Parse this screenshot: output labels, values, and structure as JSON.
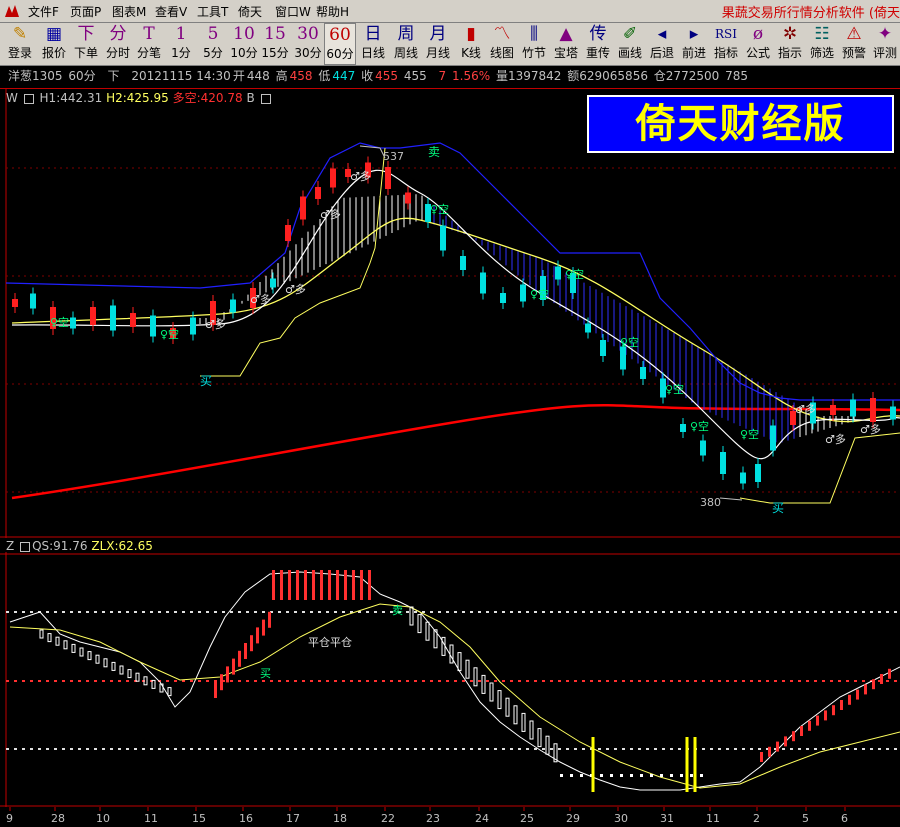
{
  "menubar": {
    "items": [
      "文件F",
      "页面P",
      "图表M",
      "查看V",
      "工具T",
      "倚天",
      "窗口W",
      "帮助H"
    ],
    "right_title": "果蔬交易所行情分析软件 (倚天"
  },
  "toolbar": [
    {
      "icon": "✎",
      "label": "登录",
      "color": "#c08000"
    },
    {
      "icon": "▦",
      "label": "报价",
      "color": "#0000a0"
    },
    {
      "icon": "下",
      "label": "下单",
      "color": "#800080"
    },
    {
      "icon": "分",
      "label": "分时",
      "color": "#800080"
    },
    {
      "icon": "T",
      "label": "分笔",
      "color": "#800080"
    },
    {
      "icon": "1",
      "label": "1分",
      "color": "#800080"
    },
    {
      "icon": "5",
      "label": "5分",
      "color": "#800080"
    },
    {
      "icon": "10",
      "label": "10分",
      "color": "#800080"
    },
    {
      "icon": "15",
      "label": "15分",
      "color": "#800080"
    },
    {
      "icon": "30",
      "label": "30分",
      "color": "#800080"
    },
    {
      "icon": "60",
      "label": "60分",
      "color": "#c00000"
    },
    {
      "icon": "日",
      "label": "日线",
      "color": "#000080"
    },
    {
      "icon": "周",
      "label": "周线",
      "color": "#000080"
    },
    {
      "icon": "月",
      "label": "月线",
      "color": "#000080"
    },
    {
      "icon": "▮",
      "label": "K线",
      "color": "#c00000"
    },
    {
      "icon": "〽",
      "label": "线图",
      "color": "#c00000"
    },
    {
      "icon": "⫼",
      "label": "竹节",
      "color": "#000080"
    },
    {
      "icon": "▲",
      "label": "宝塔",
      "color": "#800080"
    },
    {
      "icon": "传",
      "label": "重传",
      "color": "#000080"
    },
    {
      "icon": "✐",
      "label": "画线",
      "color": "#006000"
    },
    {
      "icon": "◂",
      "label": "后退",
      "color": "#000080"
    },
    {
      "icon": "▸",
      "label": "前进",
      "color": "#000080"
    },
    {
      "icon": "RSI",
      "label": "指标",
      "color": "#000080"
    },
    {
      "icon": "ø",
      "label": "公式",
      "color": "#800080"
    },
    {
      "icon": "✲",
      "label": "指示",
      "color": "#800000"
    },
    {
      "icon": "☷",
      "label": "筛选",
      "color": "#006060"
    },
    {
      "icon": "⚠",
      "label": "预警",
      "color": "#c00000"
    },
    {
      "icon": "✦",
      "label": "评测",
      "color": "#800080"
    }
  ],
  "infobar": {
    "symbol": "洋葱1305",
    "period": "60分",
    "dir": "下",
    "datetime": "20121115 14:30",
    "open_label": "开",
    "open": "448",
    "high_label": "高",
    "high": "458",
    "low_label": "低",
    "low": "447",
    "close_label": "收",
    "close": "455",
    "last": "455",
    "change": "7",
    "pct": "1.56%",
    "volume": "量1397842",
    "amount": "额629065856",
    "oi": "仓2772500",
    "extra": "785"
  },
  "main_indicator": {
    "prefix": "W",
    "h1": "H1:442.31",
    "h2": "H2:425.95",
    "dk": "多空:420.78",
    "suffix": "B"
  },
  "sub_indicator": {
    "prefix": "Z",
    "qs": "QS:91.76",
    "zlx": "ZLX:62.65"
  },
  "logo_text": "倚天财经版",
  "chart_labels": {
    "high_mark": "537",
    "low_mark": "380",
    "sell1": "卖",
    "buy1": "买",
    "buy2": "买",
    "ping": "平仓平仓",
    "sub_buy": "买",
    "sub_sell": "卖",
    "duo": "多",
    "kong": "空"
  },
  "date_axis": [
    "9",
    "28",
    "10",
    "11",
    "15",
    "16",
    "17",
    "18",
    "22",
    "23",
    "24",
    "25",
    "29",
    "30",
    "31",
    "11",
    "2",
    "5",
    "6"
  ],
  "colors": {
    "up": "#ff2020",
    "down": "#00e0e0",
    "ma_red": "#ff0000",
    "yellow": "#ffff60",
    "white": "#ffffff",
    "blue": "#2020ff"
  },
  "chart_data": {
    "type": "line",
    "x": [
      "9",
      "28",
      "10",
      "11",
      "15",
      "16",
      "17",
      "18",
      "22",
      "23",
      "24",
      "25",
      "29",
      "30",
      "31",
      "11",
      "2",
      "5",
      "6"
    ],
    "price_ylim": [
      360,
      560
    ],
    "series": [
      {
        "name": "H1",
        "values": [
          null,
          null,
          null,
          null,
          null,
          null,
          null,
          null,
          null,
          null,
          null,
          null,
          null,
          null,
          null,
          null,
          null,
          null,
          442.31
        ]
      },
      {
        "name": "H2",
        "values": [
          null,
          null,
          null,
          null,
          null,
          null,
          null,
          null,
          null,
          null,
          null,
          null,
          null,
          null,
          null,
          null,
          null,
          null,
          425.95
        ]
      },
      {
        "name": "多空",
        "values": [
          null,
          null,
          null,
          null,
          null,
          null,
          null,
          null,
          null,
          null,
          null,
          null,
          null,
          null,
          null,
          null,
          null,
          null,
          420.78
        ]
      },
      {
        "name": "QS",
        "values": [
          null,
          null,
          null,
          null,
          null,
          null,
          null,
          null,
          null,
          null,
          null,
          null,
          null,
          null,
          null,
          null,
          null,
          null,
          91.76
        ]
      },
      {
        "name": "ZLX",
        "values": [
          null,
          null,
          null,
          null,
          null,
          null,
          null,
          null,
          null,
          null,
          null,
          null,
          null,
          null,
          null,
          null,
          null,
          null,
          62.65
        ]
      }
    ],
    "annotations": [
      "537",
      "380"
    ]
  }
}
